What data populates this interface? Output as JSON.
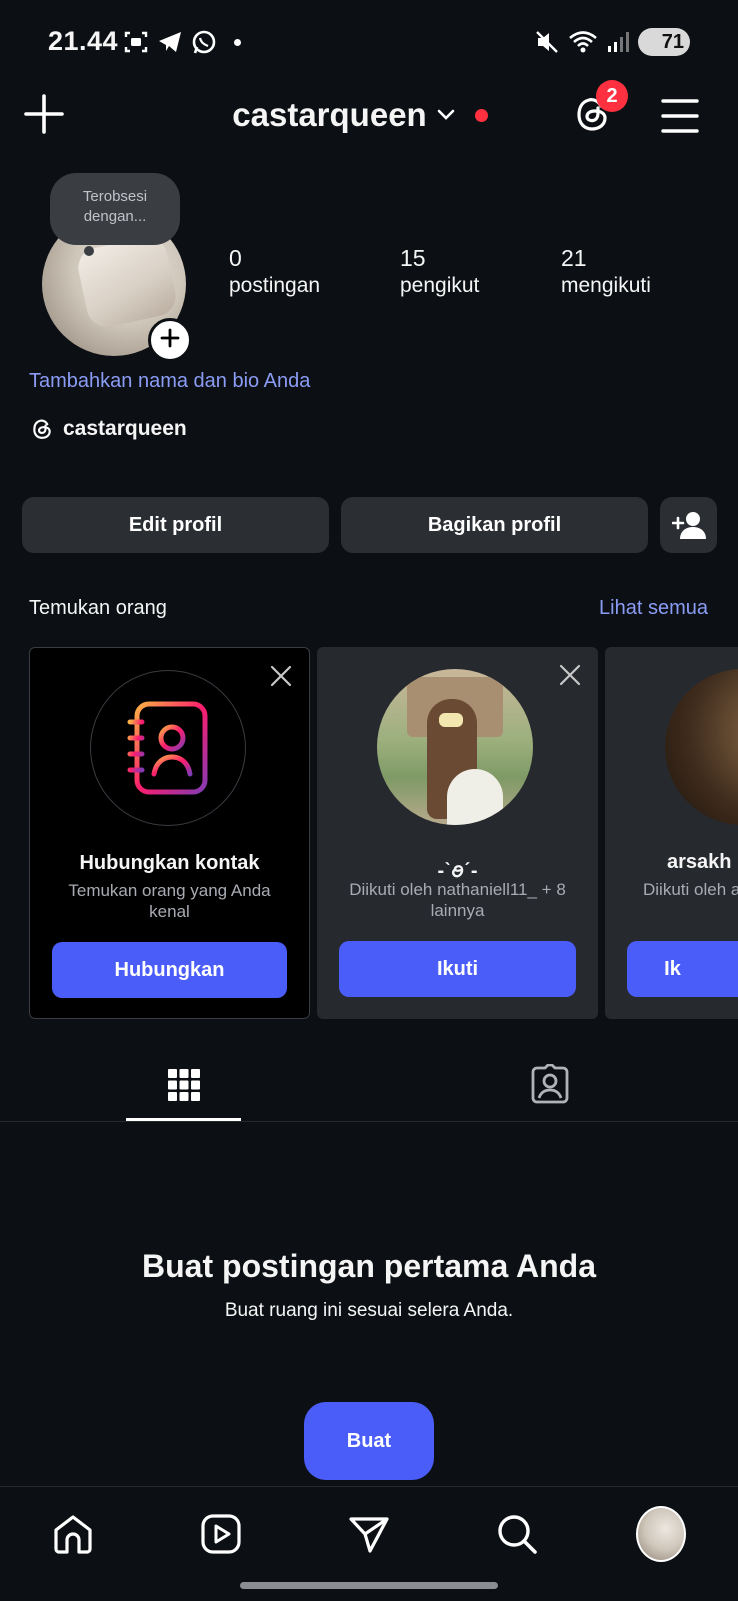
{
  "status_bar": {
    "time": "21.44",
    "battery": "71"
  },
  "header": {
    "username": "castarqueen",
    "notification_count": "2"
  },
  "profile": {
    "note": "Terobsesi dengan...",
    "stats": [
      {
        "value": "0",
        "label": "postingan"
      },
      {
        "value": "15",
        "label": "pengikut"
      },
      {
        "value": "21",
        "label": "mengikuti"
      }
    ],
    "bio_prompt": "Tambahkan nama dan bio Anda",
    "threads_handle": "castarqueen"
  },
  "actions": {
    "edit": "Edit profil",
    "share": "Bagikan profil"
  },
  "discover": {
    "title": "Temukan orang",
    "see_all": "Lihat semua",
    "cards": [
      {
        "name": "Hubungkan kontak",
        "subtitle": "Temukan orang yang Anda kenal",
        "button": "Hubungkan"
      },
      {
        "name": "-ˋꪮˊ-",
        "subtitle": "Diikuti oleh nathaniell11_ + 8 lainnya",
        "button": "Ikuti"
      },
      {
        "name": "arsakh",
        "subtitle": "Diikuti oleh a",
        "button": "Ik"
      }
    ]
  },
  "empty_state": {
    "title": "Buat postingan pertama Anda",
    "subtitle": "Buat ruang ini sesuai selera Anda.",
    "button": "Buat"
  },
  "colors": {
    "background": "#0c1014",
    "accent": "#4a5df9",
    "link": "#8b9cf5",
    "badge": "#ff3040"
  }
}
